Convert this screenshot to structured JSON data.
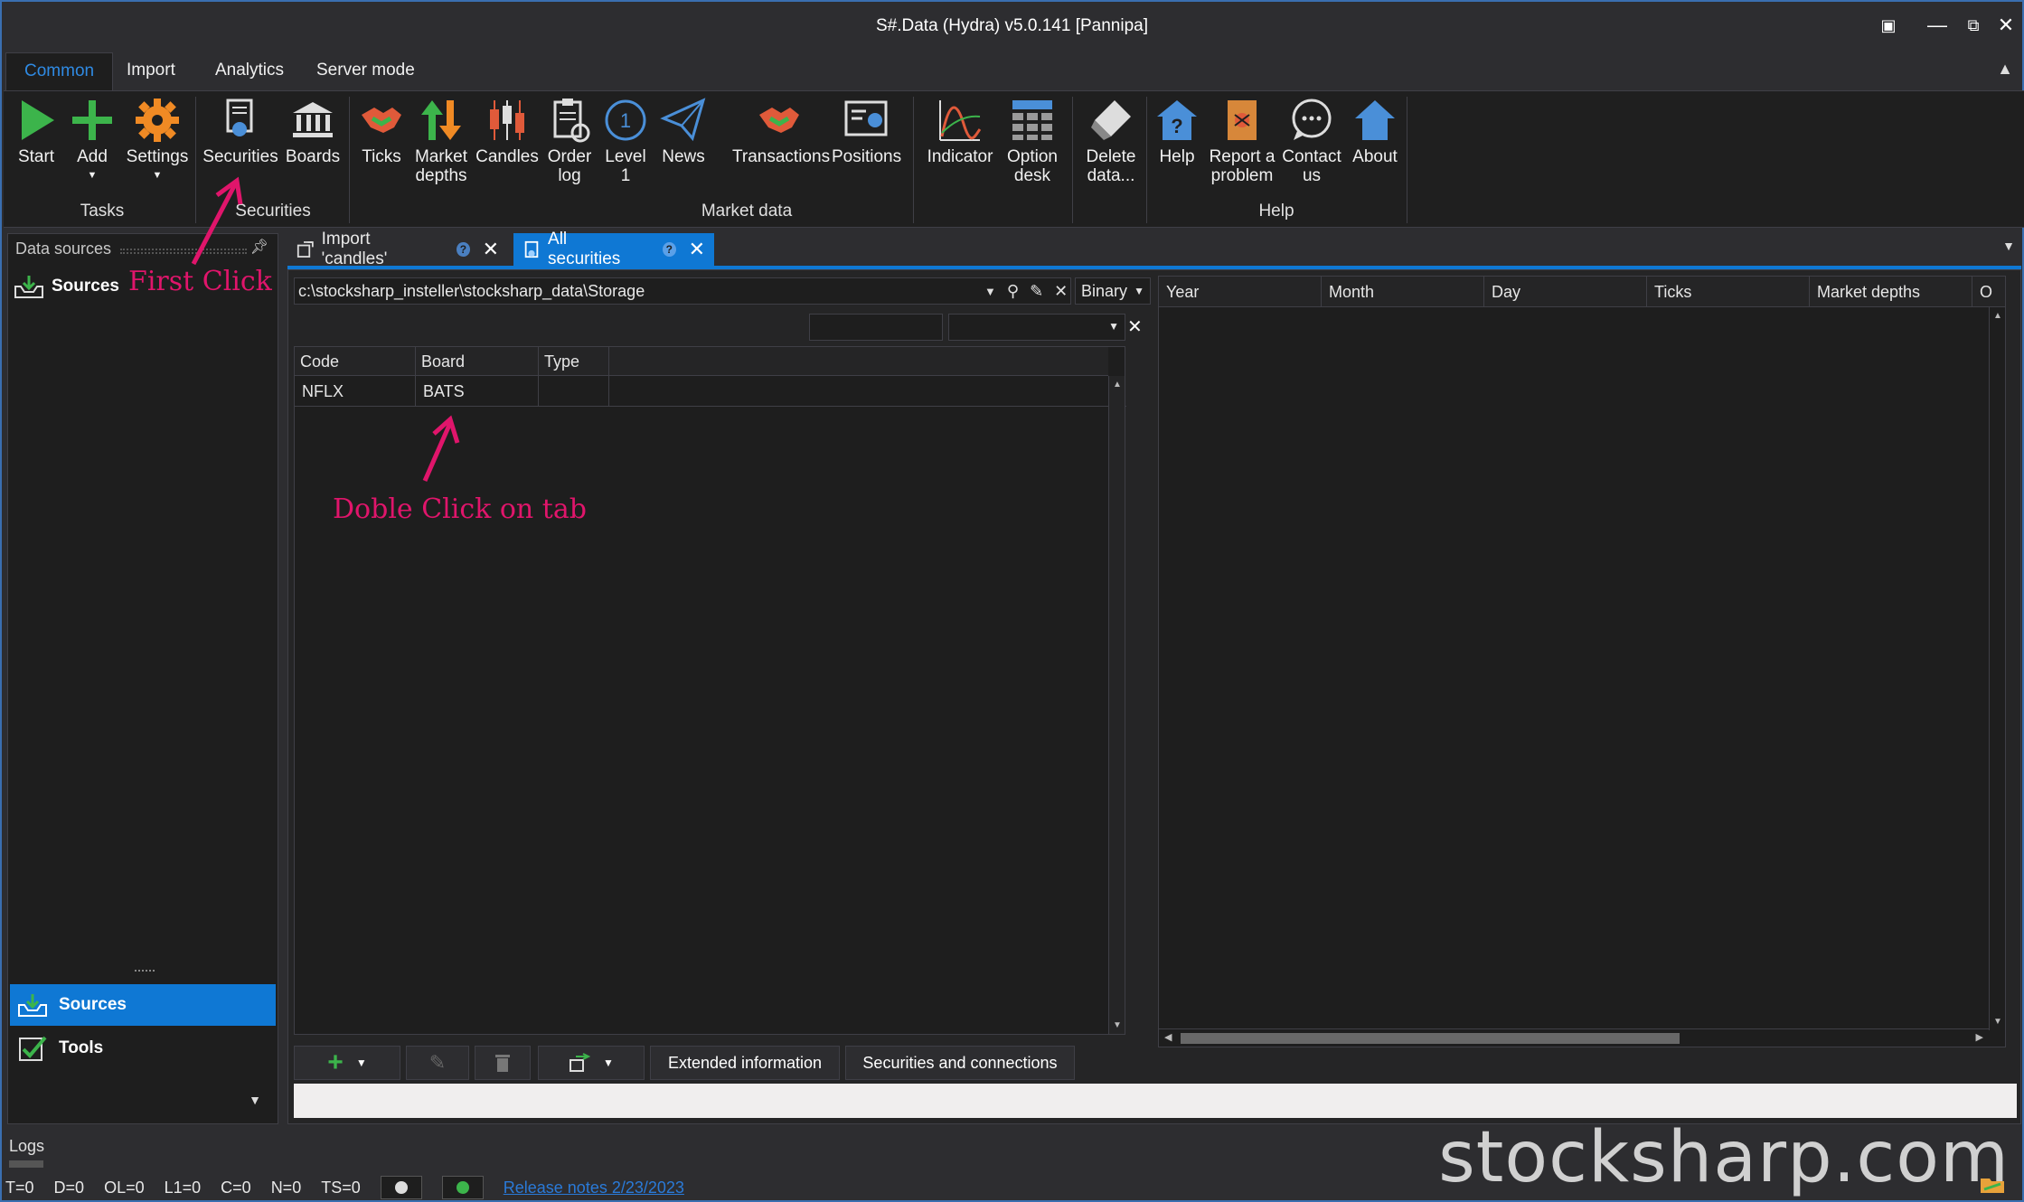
{
  "window": {
    "title": "S#.Data (Hydra) v5.0.141 [Pannipa]"
  },
  "ribbon_tabs": [
    "Common",
    "Import",
    "Analytics",
    "Server mode"
  ],
  "ribbon": {
    "start": "Start",
    "add": "Add",
    "settings": "Settings",
    "securities": "Securities",
    "boards": "Boards",
    "ticks": "Ticks",
    "market_depths": "Market depths",
    "candles": "Candles",
    "order_log": "Order log",
    "level1": "Level 1",
    "news": "News",
    "transactions": "Transactions",
    "positions": "Positions",
    "indicator": "Indicator",
    "option_desk": "Option desk",
    "delete_data": "Delete data...",
    "help": "Help",
    "report_problem": "Report a problem",
    "contact_us": "Contact us",
    "about": "About",
    "groups": {
      "tasks": "Tasks",
      "securities": "Securities",
      "market_data": "Market data",
      "help": "Help"
    }
  },
  "left_panel": {
    "header": "Data sources",
    "sources_item": "Sources",
    "nav_sources": "Sources",
    "nav_tools": "Tools"
  },
  "doc_tabs": {
    "import_candles": "Import 'candles'",
    "all_securities": "All securities"
  },
  "storage": {
    "path": "c:\\stocksharp_insteller\\stocksharp_data\\Storage",
    "format": "Binary"
  },
  "securities_grid": {
    "columns": [
      "Code",
      "Board",
      "Type"
    ],
    "rows": [
      {
        "code": "NFLX",
        "board": "BATS",
        "type": ""
      }
    ]
  },
  "data_grid": {
    "columns": [
      "Year",
      "Month",
      "Day",
      "Ticks",
      "Market depths",
      "O"
    ]
  },
  "bottom_toolbar": {
    "extended_info": "Extended information",
    "securities_connections": "Securities and connections"
  },
  "logs_label": "Logs",
  "status": {
    "t": "T=0",
    "d": "D=0",
    "ol": "OL=0",
    "l1": "L1=0",
    "c": "C=0",
    "n": "N=0",
    "ts": "TS=0",
    "release_notes": "Release notes 2/23/2023"
  },
  "annotations": {
    "first_click": "First Click",
    "double_click": "Doble Click on tab"
  },
  "watermark": "stocksharp.com",
  "colors": {
    "accent": "#0f78d4",
    "annotation": "#e0156b",
    "background": "#2d2d30"
  }
}
